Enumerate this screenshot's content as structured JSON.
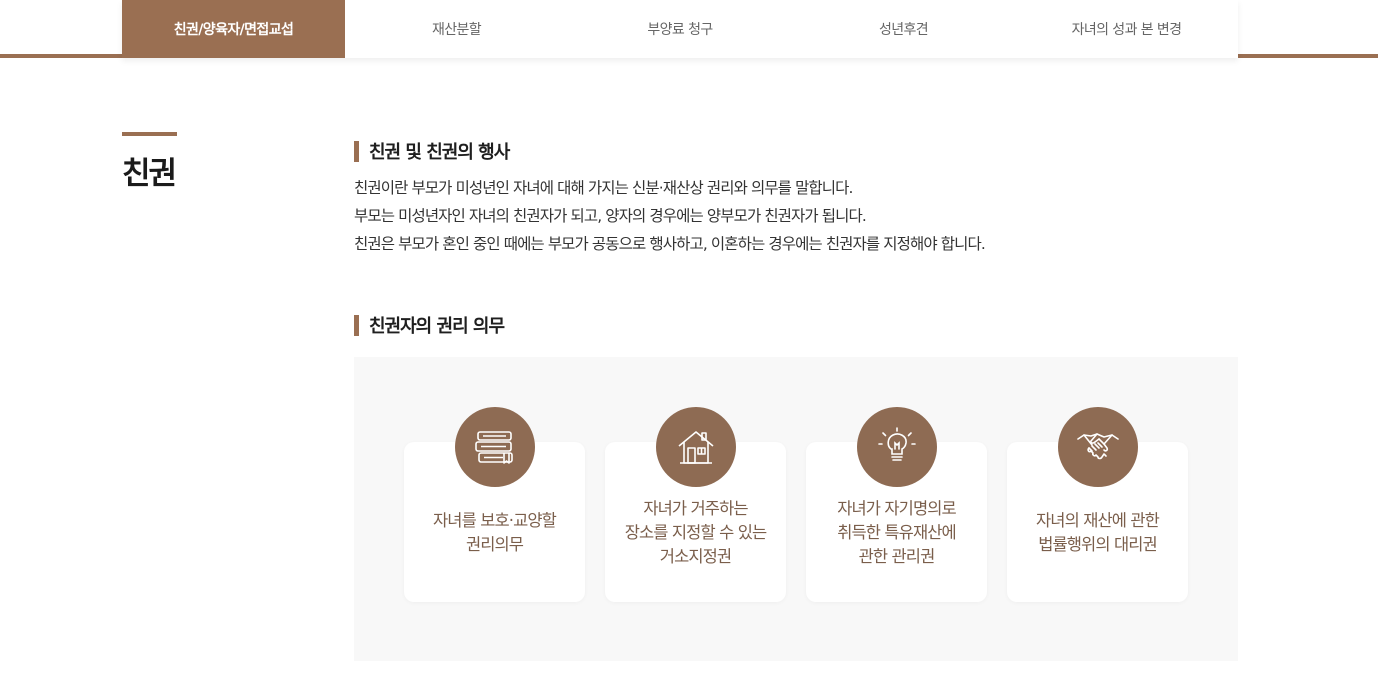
{
  "tabs": [
    {
      "label": "친권/양육자/면접교섭",
      "active": true
    },
    {
      "label": "재산분할",
      "active": false
    },
    {
      "label": "부양료 청구",
      "active": false
    },
    {
      "label": "성년후견",
      "active": false
    },
    {
      "label": "자녀의 성과 본 변경",
      "active": false
    }
  ],
  "page_title": "친권",
  "section1": {
    "heading": "친권 및 친권의 행사",
    "paragraphs": [
      "친권이란 부모가 미성년인 자녀에 대해 가지는 신분·재산상 권리와 의무를 말합니다.",
      "부모는 미성년자인 자녀의 친권자가 되고, 양자의 경우에는 양부모가 친권자가 됩니다.",
      "친권은 부모가 혼인 중인 때에는 부모가 공동으로 행사하고, 이혼하는 경우에는 친권자를 지정해야 합니다."
    ]
  },
  "section2": {
    "heading": "친권자의 권리 의무",
    "cards": [
      {
        "icon": "books-icon",
        "label": "자녀를 보호·교양할\n권리의무"
      },
      {
        "icon": "house-icon",
        "label": "자녀가 거주하는\n장소를 지정할 수 있는\n거소지정권"
      },
      {
        "icon": "lightbulb-icon",
        "label": "자녀가 자기명의로\n취득한 특유재산에\n관한 관리권"
      },
      {
        "icon": "handshake-icon",
        "label": "자녀의 재산에 관한\n법률행위의 대리권"
      }
    ]
  },
  "colors": {
    "accent": "#9a6f52",
    "icon_bg": "#8e6b53",
    "card_text": "#7a5e4b",
    "panel_bg": "#f8f8f8"
  }
}
